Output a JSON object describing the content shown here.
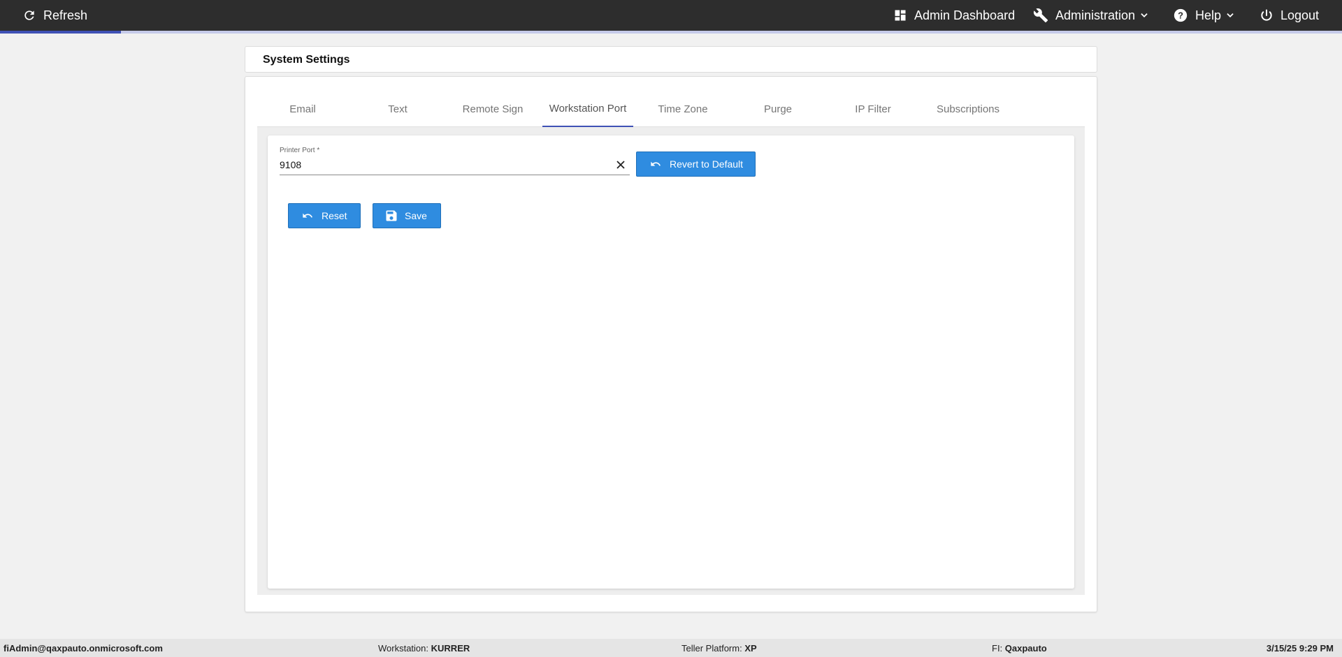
{
  "topbar": {
    "refresh_label": "Refresh",
    "admin_dashboard_label": "Admin Dashboard",
    "administration_label": "Administration",
    "help_label": "Help",
    "logout_label": "Logout",
    "load_progress": 0.09
  },
  "page": {
    "title": "System Settings"
  },
  "tabs": [
    {
      "label": "Email"
    },
    {
      "label": "Text"
    },
    {
      "label": "Remote Sign"
    },
    {
      "label": "Workstation Port",
      "active": true
    },
    {
      "label": "Time Zone"
    },
    {
      "label": "Purge"
    },
    {
      "label": "IP Filter"
    },
    {
      "label": "Subscriptions"
    }
  ],
  "form": {
    "printer_port_label": "Printer Port *",
    "printer_port_value": "9108",
    "revert_label": "Revert to Default",
    "reset_label": "Reset",
    "save_label": "Save"
  },
  "footer": {
    "user": "fiAdmin@qaxpauto.onmicrosoft.com",
    "workstation_label": "Workstation:",
    "workstation_value": "KURRER",
    "teller_platform_label": "Teller Platform:",
    "teller_platform_value": "XP",
    "fi_label": "FI:",
    "fi_value": "Qaxpauto",
    "datetime": "3/15/25 9:29 PM"
  },
  "colors": {
    "topbar_bg": "#2d2d2d",
    "accent": "#3f51b5",
    "button_blue": "#2f8ce0"
  },
  "icons": {
    "refresh": "refresh-icon",
    "dashboard": "dashboard-icon",
    "administration": "wrench-icon",
    "help": "help-circle-icon",
    "logout": "power-icon",
    "clear": "close-icon",
    "revert": "undo-icon",
    "reset": "undo-icon",
    "save": "floppy-disk-icon"
  }
}
